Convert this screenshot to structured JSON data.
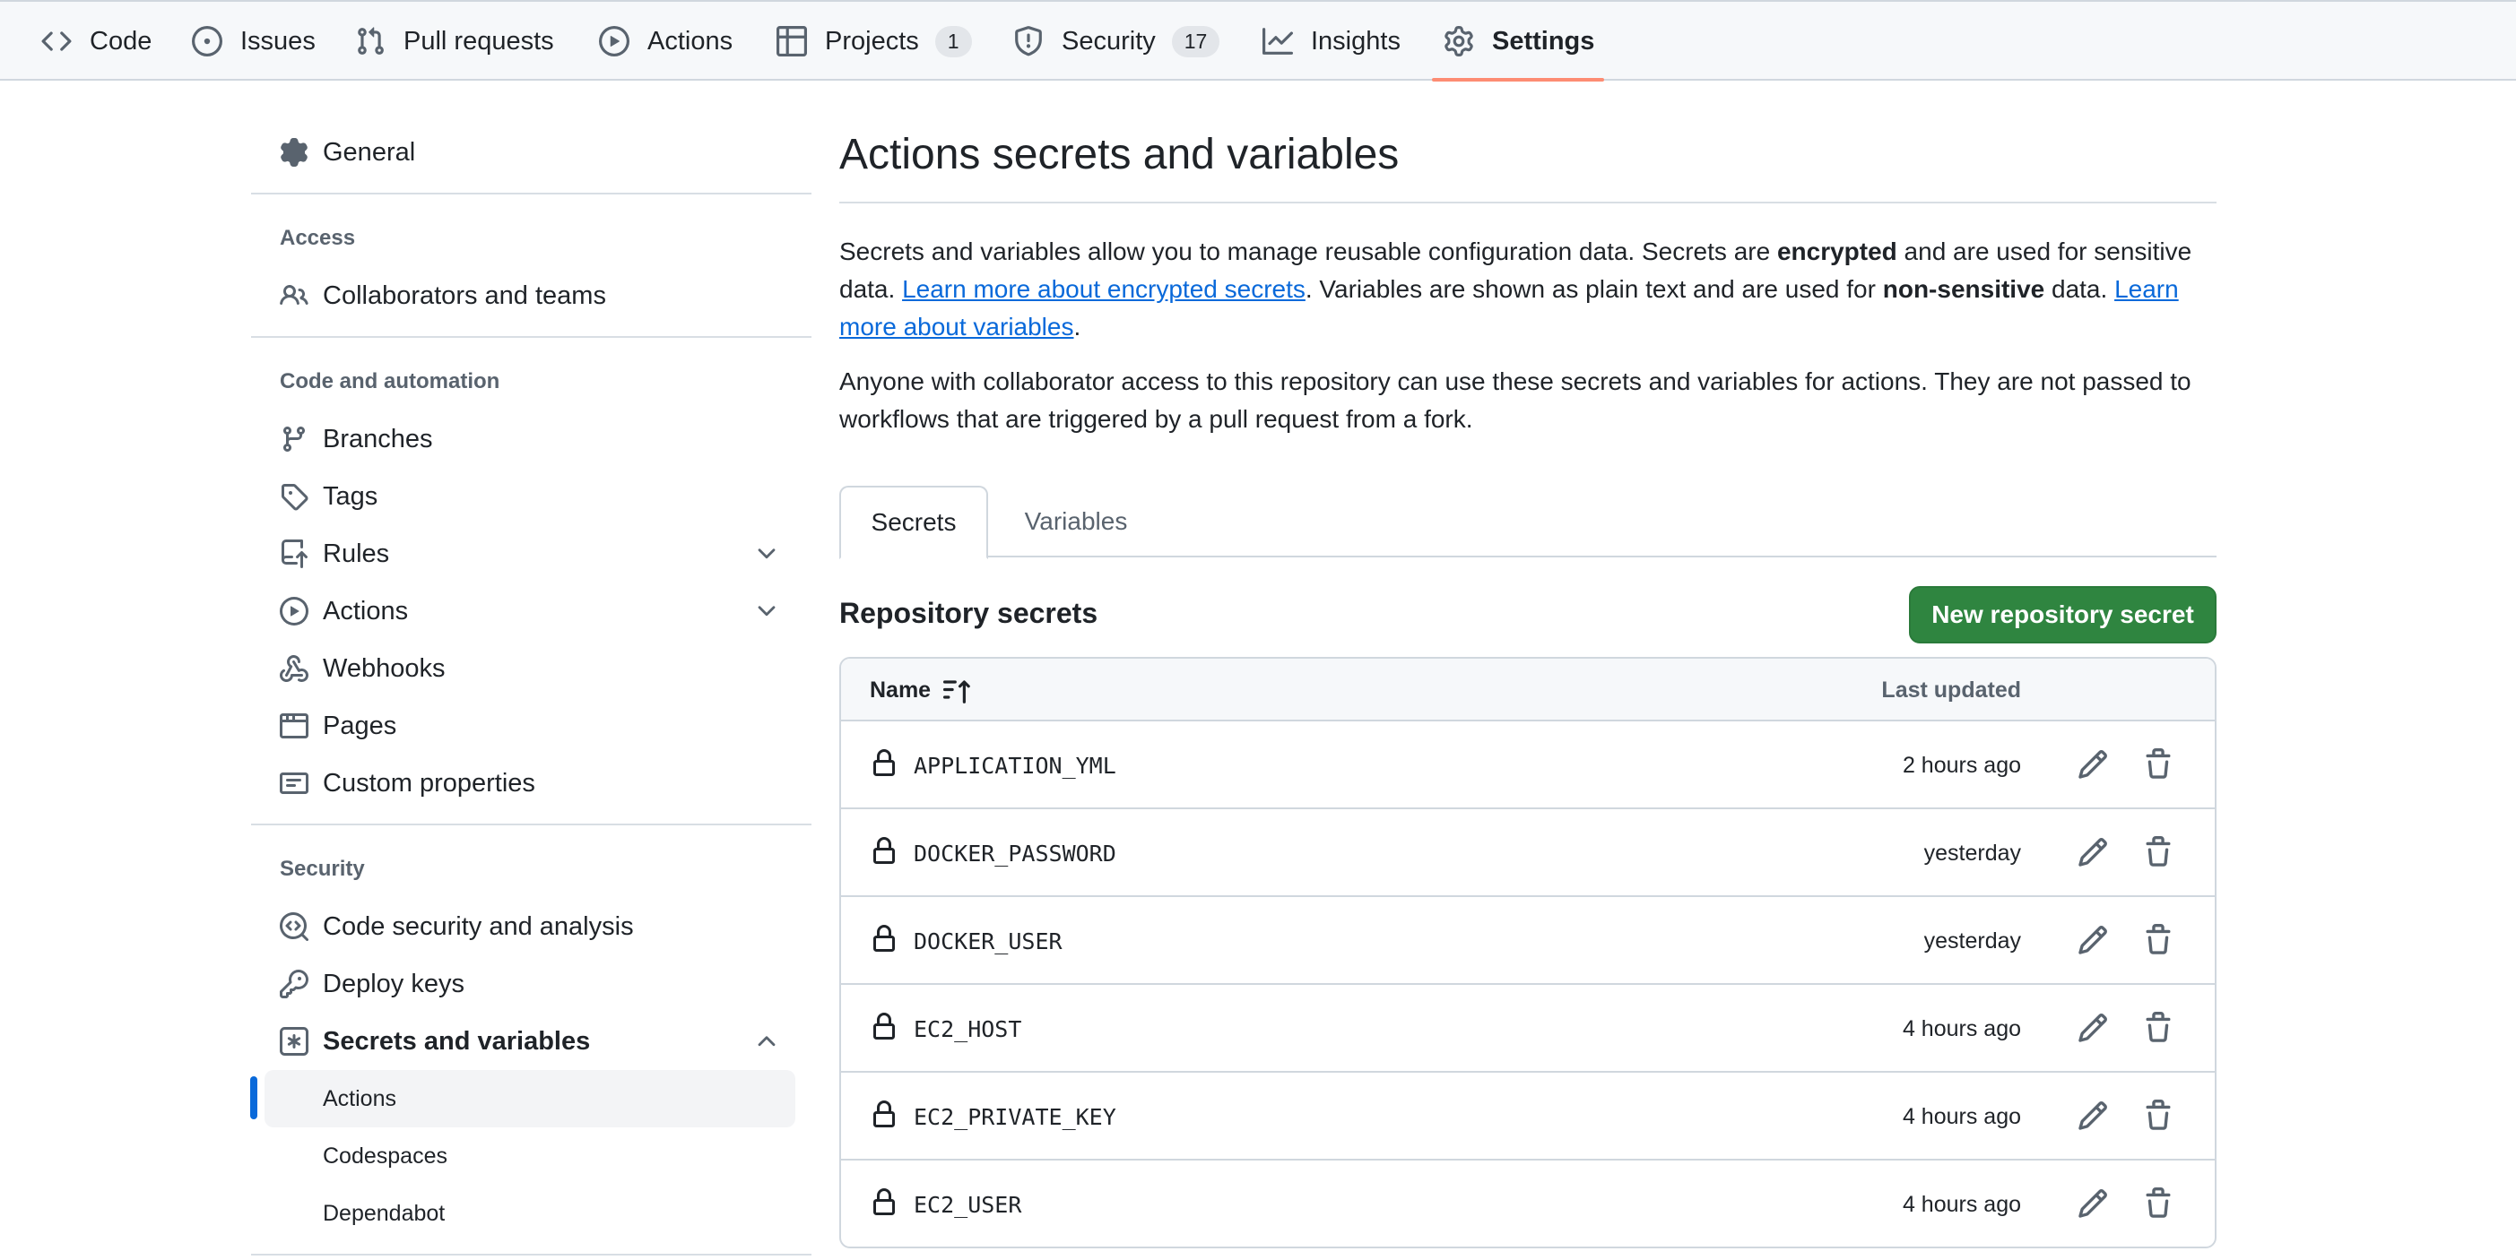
{
  "topnav": {
    "tabs": [
      {
        "label": "Code",
        "icon": "code-icon"
      },
      {
        "label": "Issues",
        "icon": "issue-opened-icon"
      },
      {
        "label": "Pull requests",
        "icon": "git-pull-request-icon"
      },
      {
        "label": "Actions",
        "icon": "play-icon"
      },
      {
        "label": "Projects",
        "icon": "table-icon",
        "count": "1"
      },
      {
        "label": "Security",
        "icon": "shield-icon",
        "count": "17"
      },
      {
        "label": "Insights",
        "icon": "graph-icon"
      },
      {
        "label": "Settings",
        "icon": "gear-icon",
        "active": true
      }
    ]
  },
  "sidebar": {
    "general": "General",
    "access_heading": "Access",
    "collaborators": "Collaborators and teams",
    "code_automation_heading": "Code and automation",
    "branches": "Branches",
    "tags": "Tags",
    "rules": "Rules",
    "actions": "Actions",
    "webhooks": "Webhooks",
    "pages": "Pages",
    "custom_properties": "Custom properties",
    "security_heading": "Security",
    "code_security": "Code security and analysis",
    "deploy_keys": "Deploy keys",
    "secrets_variables": "Secrets and variables",
    "sub_actions": "Actions",
    "sub_codespaces": "Codespaces",
    "sub_dependabot": "Dependabot"
  },
  "main": {
    "title": "Actions secrets and variables",
    "para1": {
      "t1": "Secrets and variables allow you to manage reusable configuration data. Secrets are ",
      "b1": "encrypted",
      "t2": " and are used for sensitive data. ",
      "link1": "Learn more about encrypted secrets",
      "t3": ". Variables are shown as plain text and are used for ",
      "b2": "non-sensitive",
      "t4": " data. ",
      "link2": "Learn more about variables",
      "t5": "."
    },
    "para2": "Anyone with collaborator access to this repository can use these secrets and variables for actions. They are not passed to workflows that are triggered by a pull request from a fork.",
    "tabs": {
      "secrets": "Secrets",
      "variables": "Variables"
    },
    "section_title": "Repository secrets",
    "new_button": "New repository secret",
    "table": {
      "col_name": "Name",
      "col_updated": "Last updated",
      "rows": [
        {
          "name": "APPLICATION_YML",
          "updated": "2 hours ago"
        },
        {
          "name": "DOCKER_PASSWORD",
          "updated": "yesterday"
        },
        {
          "name": "DOCKER_USER",
          "updated": "yesterday"
        },
        {
          "name": "EC2_HOST",
          "updated": "4 hours ago"
        },
        {
          "name": "EC2_PRIVATE_KEY",
          "updated": "4 hours ago"
        },
        {
          "name": "EC2_USER",
          "updated": "4 hours ago"
        }
      ]
    }
  },
  "colors": {
    "accent": "#0969da",
    "primary_button": "#2f8540",
    "active_tab_underline": "#fd8c73"
  }
}
